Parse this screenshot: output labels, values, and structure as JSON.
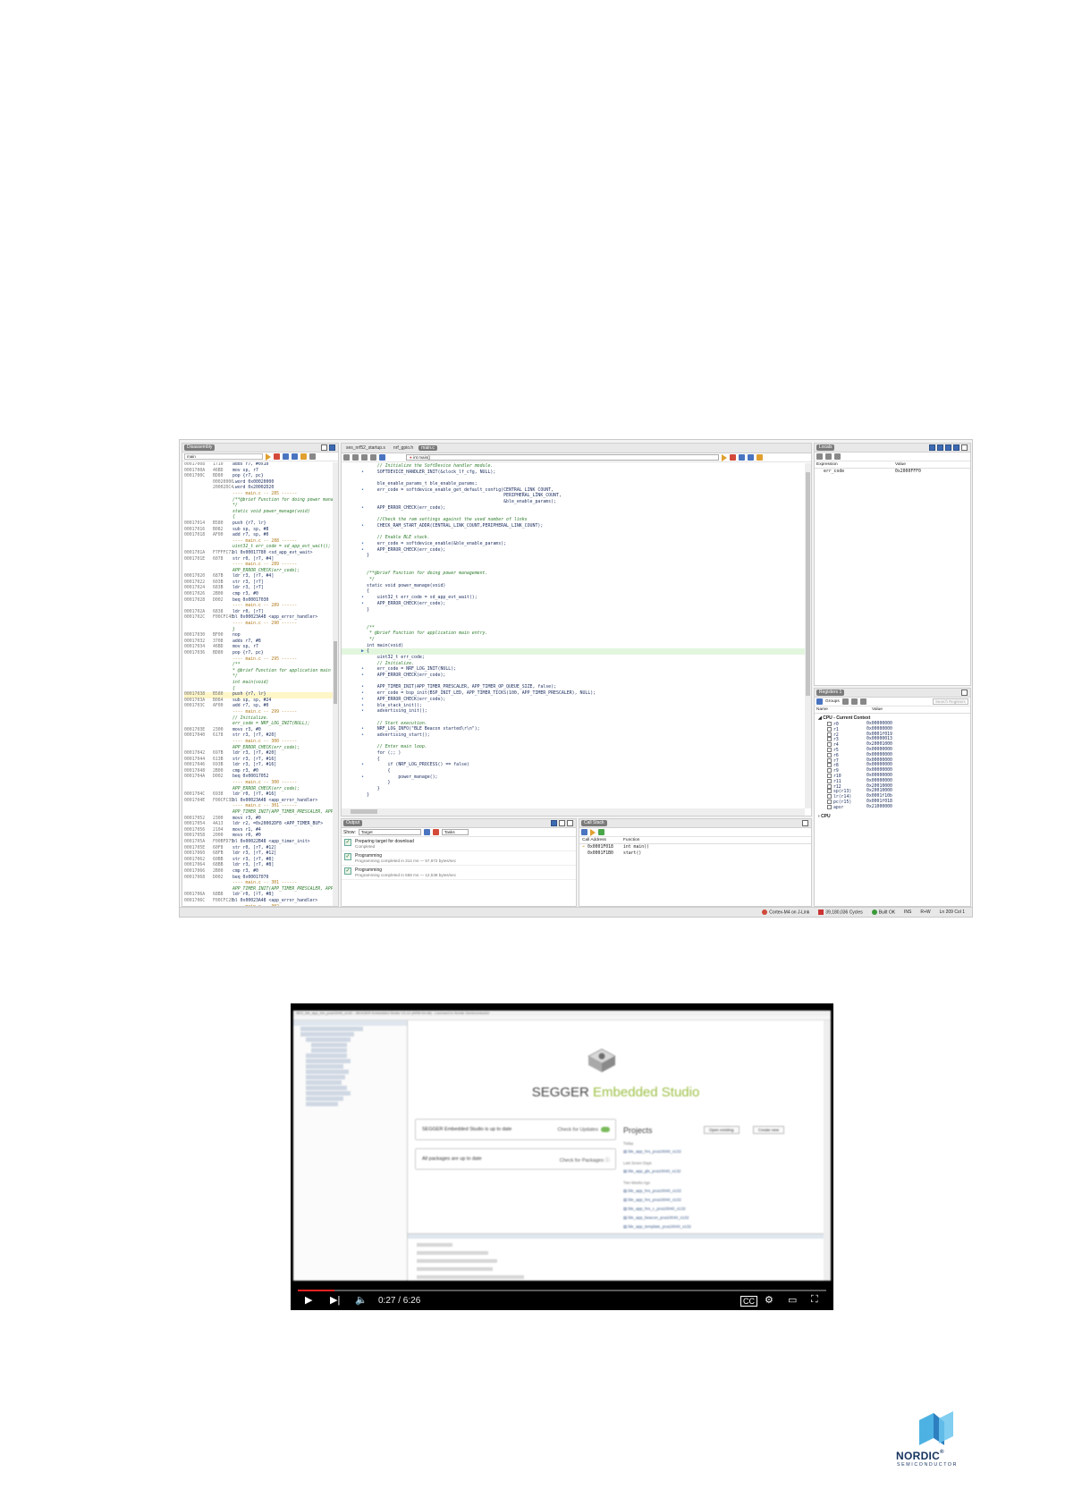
{
  "ide": {
    "disassembly": {
      "title": "Disassembly",
      "filter_value": "main",
      "lines": [
        [
          "00017008",
          "1710",
          "adds r7, #0x10"
        ],
        [
          "0001700A",
          "46BD",
          "mov sp, r7"
        ],
        [
          "0001700C",
          "BD80",
          "pop {r7, pc}"
        ],
        [
          "",
          "00020000",
          ".word 0x00020000"
        ],
        [
          "",
          "20002DC4",
          ".word 0x20002D20"
        ],
        [
          "",
          "",
          "---- main.c -- 285 ------"
        ],
        [
          "",
          "",
          "/**@brief Function for doing power management."
        ],
        [
          "",
          "",
          "*/"
        ],
        [
          "",
          "",
          "static void power_manage(void)"
        ],
        [
          "",
          "",
          "{"
        ],
        [
          "00017014",
          "B580",
          "push {r7, lr}"
        ],
        [
          "00017016",
          "B082",
          "sub sp, sp, #8"
        ],
        [
          "00017018",
          "AF00",
          "add r7, sp, #0"
        ],
        [
          "",
          "",
          "---- main.c -- 288 ------"
        ],
        [
          "",
          "",
          "uint32_t err_code = sd_app_evt_wait();"
        ],
        [
          "0001701A",
          "F7FFFC71",
          "bl 0x00017780 <sd_app_evt_wait>"
        ],
        [
          "0001701E",
          "6078",
          "str r0, [r7, #4]"
        ],
        [
          "",
          "",
          "---- main.c -- 289 ------"
        ],
        [
          "",
          "",
          "APP_ERROR_CHECK(err_code);"
        ],
        [
          "00017020",
          "687B",
          "ldr r3, [r7, #4]"
        ],
        [
          "00017022",
          "603B",
          "str r3, [r7]"
        ],
        [
          "00017024",
          "683B",
          "ldr r3, [r7]"
        ],
        [
          "00017026",
          "2B00",
          "cmp r3, #0"
        ],
        [
          "00017028",
          "D002",
          "beq 0x00017030"
        ],
        [
          "",
          "",
          "---- main.c -- 289 ------"
        ],
        [
          "0001702A",
          "6838",
          "ldr r0, [r7]"
        ],
        [
          "0001702C",
          "F00CFC4E",
          "bl 0x00023A48 <app_error_handler>"
        ],
        [
          "",
          "",
          "---- main.c -- 290 ------"
        ],
        [
          "",
          "",
          "}"
        ],
        [
          "00017030",
          "BF00",
          "nop"
        ],
        [
          "00017032",
          "3708",
          "adds r7, #8"
        ],
        [
          "00017034",
          "46BD",
          "mov sp, r7"
        ],
        [
          "00017036",
          "BD80",
          "pop {r7, pc}"
        ],
        [
          "",
          "",
          "---- main.c -- 295 ------"
        ],
        [
          "",
          "",
          "/**"
        ],
        [
          "",
          "",
          "* @brief Function for application main entry."
        ],
        [
          "",
          "",
          "*/"
        ],
        [
          "",
          "",
          "int main(void)"
        ],
        [
          "",
          "",
          "{"
        ],
        [
          "00017038",
          "B580",
          "push {r7, lr}"
        ],
        [
          "0001703A",
          "B084",
          "sub sp, sp, #24"
        ],
        [
          "0001703C",
          "AF00",
          "add r7, sp, #0"
        ],
        [
          "",
          "",
          "---- main.c -- 299 ------"
        ],
        [
          "",
          "",
          "// Initialize."
        ],
        [
          "",
          "",
          "err_code = NRF_LOG_INIT(NULL);"
        ],
        [
          "0001703E",
          "2300",
          "movs r3, #0"
        ],
        [
          "00017040",
          "6178",
          "str r3, [r7, #20]"
        ],
        [
          "",
          "",
          "---- main.c -- 300 ------"
        ],
        [
          "",
          "",
          "APP_ERROR_CHECK(err_code);"
        ],
        [
          "00017042",
          "697B",
          "ldr r3, [r7, #20]"
        ],
        [
          "00017044",
          "613B",
          "str r3, [r7, #16]"
        ],
        [
          "00017046",
          "693B",
          "ldr r3, [r7, #16]"
        ],
        [
          "00017048",
          "2B00",
          "cmp r3, #0"
        ],
        [
          "0001704A",
          "D002",
          "beq 0x00017052"
        ],
        [
          "",
          "",
          "---- main.c -- 300 ------"
        ],
        [
          "",
          "",
          "APP_ERROR_CHECK(err_code);"
        ],
        [
          "0001704C",
          "6938",
          "ldr r0, [r7, #16]"
        ],
        [
          "0001704E",
          "F00CFC3D",
          "bl 0x00023A48 <app_error_handler>"
        ],
        [
          "",
          "",
          "---- main.c -- 301 ------"
        ],
        [
          "",
          "",
          "APP_TIMER_INIT(APP_TIMER_PRESCALER, APP_TIMER_OP_QUEUE_SIZE, false);"
        ],
        [
          "00017052",
          "2300",
          "movs r3, #0"
        ],
        [
          "00017054",
          "4A13",
          "ldr r2, =0x20002DF8 <APP_TIMER_BUF>"
        ],
        [
          "00017056",
          "2104",
          "movs r1, #4"
        ],
        [
          "00017058",
          "2000",
          "movs r0, #0"
        ],
        [
          "0001705A",
          "F00BFD75",
          "bl 0x00022B48 <app_timer_init>"
        ],
        [
          "0001705E",
          "60F8",
          "str r0, [r7, #12]"
        ],
        [
          "00017060",
          "68FB",
          "ldr r3, [r7, #12]"
        ],
        [
          "00017062",
          "60BB",
          "str r3, [r7, #8]"
        ],
        [
          "00017064",
          "68BB",
          "ldr r3, [r7, #8]"
        ],
        [
          "00017066",
          "2B00",
          "cmp r3, #0"
        ],
        [
          "00017068",
          "D002",
          "beq 0x00017070"
        ],
        [
          "",
          "",
          "---- main.c -- 301 ------"
        ],
        [
          "",
          "",
          "APP_TIMER_INIT(APP_TIMER_PRESCALER, APP_TIMER_OP_QUEUE_SIZE"
        ],
        [
          "0001706A",
          "68B8",
          "ldr r0, [r7, #8]"
        ],
        [
          "0001706C",
          "F00CFC2E",
          "bl 0x00023A48 <app_error_handler>"
        ],
        [
          "",
          "",
          "---- main.c -- 302 ------"
        ],
        [
          "",
          "",
          "err_code = bsp_init(BSP_INIT_LED, APP_TIMER_TICKS(100,"
        ],
        [
          "00017070",
          "2164",
          "movs r1, #100"
        ],
        [
          "00017072",
          "F240C3CC",
          "movw r3, #0xCCD"
        ],
        [
          "00017076",
          "2001",
          "movs r0, #1"
        ]
      ]
    },
    "editor": {
      "tabs": [
        "ses_nrf52_startup.s",
        "nrf_gpio.h",
        "main.c"
      ],
      "function_selector": "int main()",
      "lines": [
        [
          "",
          "",
          "    // Initialize the SoftDevice handler module."
        ],
        [
          "",
          "•",
          "    SOFTDEVICE_HANDLER_INIT(&clock_lf_cfg, NULL);"
        ],
        [
          "",
          "",
          ""
        ],
        [
          "",
          "",
          "    ble_enable_params_t ble_enable_params;"
        ],
        [
          "",
          "•",
          "    err_code = softdevice_enable_get_default_config(CENTRAL_LINK_COUNT,"
        ],
        [
          "",
          "",
          "                                                    PERIPHERAL_LINK_COUNT,"
        ],
        [
          "",
          "",
          "                                                    &ble_enable_params);"
        ],
        [
          "",
          "•",
          "    APP_ERROR_CHECK(err_code);"
        ],
        [
          "",
          "",
          ""
        ],
        [
          "",
          "",
          "    //Check the ram settings against the used number of links"
        ],
        [
          "",
          "•",
          "    CHECK_RAM_START_ADDR(CENTRAL_LINK_COUNT,PERIPHERAL_LINK_COUNT);"
        ],
        [
          "",
          "",
          ""
        ],
        [
          "",
          "",
          "    // Enable BLE stack."
        ],
        [
          "",
          "•",
          "    err_code = softdevice_enable(&ble_enable_params);"
        ],
        [
          "",
          "•",
          "    APP_ERROR_CHECK(err_code);"
        ],
        [
          "",
          "",
          "}"
        ],
        [
          "",
          "",
          ""
        ],
        [
          "",
          "",
          ""
        ],
        [
          "",
          "",
          "/**@brief Function for doing power management."
        ],
        [
          "",
          "",
          " */"
        ],
        [
          "",
          "",
          "static void power_manage(void)"
        ],
        [
          "",
          "",
          "{"
        ],
        [
          "",
          "•",
          "    uint32_t err_code = sd_app_evt_wait();"
        ],
        [
          "",
          "•",
          "    APP_ERROR_CHECK(err_code);"
        ],
        [
          "",
          "",
          "}"
        ],
        [
          "",
          "",
          ""
        ],
        [
          "",
          "",
          ""
        ],
        [
          "",
          "",
          "/**"
        ],
        [
          "",
          "",
          " * @brief Function for application main entry."
        ],
        [
          "",
          "",
          " */"
        ],
        [
          "",
          "",
          "int main(void)"
        ],
        [
          "",
          "▶",
          "{"
        ],
        [
          "",
          "",
          "    uint32_t err_code;"
        ],
        [
          "",
          "",
          "    // Initialize."
        ],
        [
          "",
          "•",
          "    err_code = NRF_LOG_INIT(NULL);"
        ],
        [
          "",
          "•",
          "    APP_ERROR_CHECK(err_code);"
        ],
        [
          "",
          "",
          ""
        ],
        [
          "",
          "•",
          "    APP_TIMER_INIT(APP_TIMER_PRESCALER, APP_TIMER_OP_QUEUE_SIZE, false);"
        ],
        [
          "",
          "•",
          "    err_code = bsp_init(BSP_INIT_LED, APP_TIMER_TICKS(100, APP_TIMER_PRESCALER), NULL);"
        ],
        [
          "",
          "•",
          "    APP_ERROR_CHECK(err_code);"
        ],
        [
          "",
          "•",
          "    ble_stack_init();"
        ],
        [
          "",
          "•",
          "    advertising_init();"
        ],
        [
          "",
          "",
          ""
        ],
        [
          "",
          "",
          "    // Start execution."
        ],
        [
          "",
          "•",
          "    NRF_LOG_INFO(\"BLE Beacon started\\r\\n\");"
        ],
        [
          "",
          "•",
          "    advertising_start();"
        ],
        [
          "",
          "",
          ""
        ],
        [
          "",
          "",
          "    // Enter main loop."
        ],
        [
          "",
          "",
          "    for (;; )"
        ],
        [
          "",
          "",
          "    {"
        ],
        [
          "",
          "•",
          "        if (NRF_LOG_PROCESS() == false)"
        ],
        [
          "",
          "",
          "        {"
        ],
        [
          "",
          "•",
          "            power_manage();"
        ],
        [
          "",
          "",
          "        }"
        ],
        [
          "",
          "",
          "    }"
        ],
        [
          "",
          "",
          "}"
        ],
        [
          "",
          "",
          ""
        ],
        [
          "",
          "",
          ""
        ],
        [
          "",
          "",
          "/**"
        ],
        [
          "",
          "",
          " * @}"
        ],
        [
          "",
          "",
          " */"
        ]
      ]
    },
    "locals": {
      "title": "Locals",
      "col_expression": "Expression",
      "col_value": "Value",
      "rows": [
        [
          "err_code",
          "0x2000FFF0"
        ]
      ]
    },
    "registers": {
      "title": "Registers 1",
      "groups_label": "Groups",
      "search_placeholder": "Search Registers",
      "col_name": "Name",
      "col_value": "Value",
      "group_title": "CPU - Current Context",
      "rows": [
        [
          "r0",
          "0x00000000"
        ],
        [
          "r1",
          "0x00000000"
        ],
        [
          "r2",
          "0x0001f019"
        ],
        [
          "r3",
          "0x00000013"
        ],
        [
          "r4",
          "0x20001000"
        ],
        [
          "r5",
          "0x00000000"
        ],
        [
          "r6",
          "0x00000000"
        ],
        [
          "r7",
          "0x00000000"
        ],
        [
          "r8",
          "0x00000000"
        ],
        [
          "r9",
          "0x00000000"
        ],
        [
          "r10",
          "0x00000000"
        ],
        [
          "r11",
          "0x00000000"
        ],
        [
          "r12",
          "0x20010000"
        ],
        [
          "sp(r13)",
          "0x20010000"
        ],
        [
          "lr(r14)",
          "0x0001f10b"
        ],
        [
          "pc(r15)",
          "0x0001f018"
        ],
        [
          "apsr",
          "0x21000000"
        ]
      ],
      "cpu_label": "CPU"
    },
    "output": {
      "title": "Output",
      "show_label": "Show:",
      "show_value": "Target",
      "tasks_value": "Tasks",
      "items": [
        {
          "title": "Preparing target for download",
          "sub": "Completed"
        },
        {
          "title": "Programming",
          "sub": "Programming completed in 314 ms — 57,972 bytes/sec"
        },
        {
          "title": "Programming",
          "sub": "Programming completed in 558 ms — 12,538 bytes/sec"
        }
      ]
    },
    "callstack": {
      "title": "Call Stack",
      "col_address": "Call Address",
      "col_function": "Function",
      "rows": [
        [
          "0x0001F018",
          "int main()"
        ],
        [
          "0x0001F1B0",
          "start()"
        ]
      ]
    },
    "status": {
      "target": "Cortex-M4 on J-Link",
      "cycles": "39,180,036 Cycles",
      "build": "Built OK",
      "ins": "INS",
      "mode": "R+W",
      "position": "Ln 209 Col 1"
    }
  },
  "video": {
    "window_title": "SES_ble_app_hrs_pca10040_s132 - SEGGER Embedded Studio V3.10 (ARM 64-bit) - Licensed to Nordic Semiconductor",
    "brand_left": "SEGGER",
    "brand_right": "Embedded Studio",
    "status_card": "SEGGER Embedded Studio is up to date",
    "status_action": "Check for Updates",
    "packages_card": "All packages are up to date",
    "packages_action": "Check for Packages",
    "projects_title": "Projects",
    "open_existing": "Open existing",
    "create_new": "Create new",
    "groups": [
      {
        "label": "Today",
        "items": [
          "ble_app_hrs_pca10040_s132"
        ]
      },
      {
        "label": "Last Seven Days",
        "items": [
          "ble_app_gls_pca10040_s132"
        ]
      },
      {
        "label": "Two Weeks Ago",
        "items": [
          "ble_app_hrs_pca10040_s132",
          "ble_app_hrs_pca10040_s132",
          "ble_app_hrs_c_pca10040_s132",
          "ble_app_beacon_pca10040_s132",
          "ble_app_template_pca10040_s132"
        ]
      }
    ],
    "time": "0:27 / 6:26",
    "progress": 0.069
  },
  "logo": {
    "wordmark": "NORDIC",
    "registered": "®",
    "tagline": "SEMICONDUCTOR",
    "color": "#15325f"
  }
}
